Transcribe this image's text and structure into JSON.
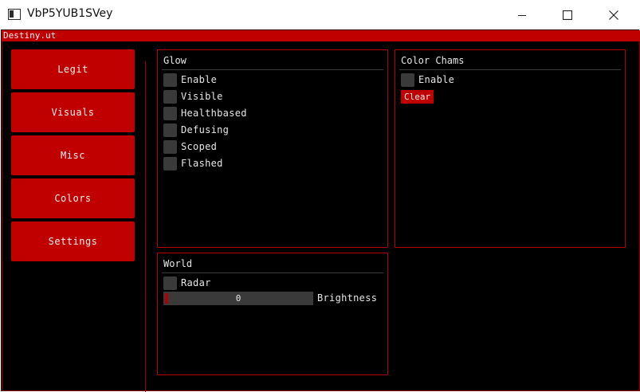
{
  "window": {
    "title": "VbP5YUB1SVey",
    "controls": [
      "minimize",
      "maximize",
      "close"
    ]
  },
  "menu": {
    "title": "Destiny.ut"
  },
  "nav": {
    "items": [
      {
        "label": "Legit"
      },
      {
        "label": "Visuals"
      },
      {
        "label": "Misc"
      },
      {
        "label": "Colors"
      },
      {
        "label": "Settings"
      }
    ]
  },
  "glow": {
    "title": "Glow",
    "options": [
      {
        "label": "Enable",
        "checked": false
      },
      {
        "label": "Visible",
        "checked": false
      },
      {
        "label": "Healthbased",
        "checked": false
      },
      {
        "label": "Defusing",
        "checked": false
      },
      {
        "label": "Scoped",
        "checked": false
      },
      {
        "label": "Flashed",
        "checked": false
      }
    ]
  },
  "color_chams": {
    "title": "Color Chams",
    "enable": {
      "label": "Enable",
      "checked": false
    },
    "clear_button": "Clear"
  },
  "world": {
    "title": "World",
    "radar": {
      "label": "Radar",
      "checked": false
    },
    "brightness": {
      "value": "0",
      "label": "Brightness"
    }
  },
  "colors": {
    "accent": "#c00000",
    "border": "#b00000",
    "background": "#000000",
    "frame": "#3a3a3a",
    "text": "#e6e6e6"
  }
}
